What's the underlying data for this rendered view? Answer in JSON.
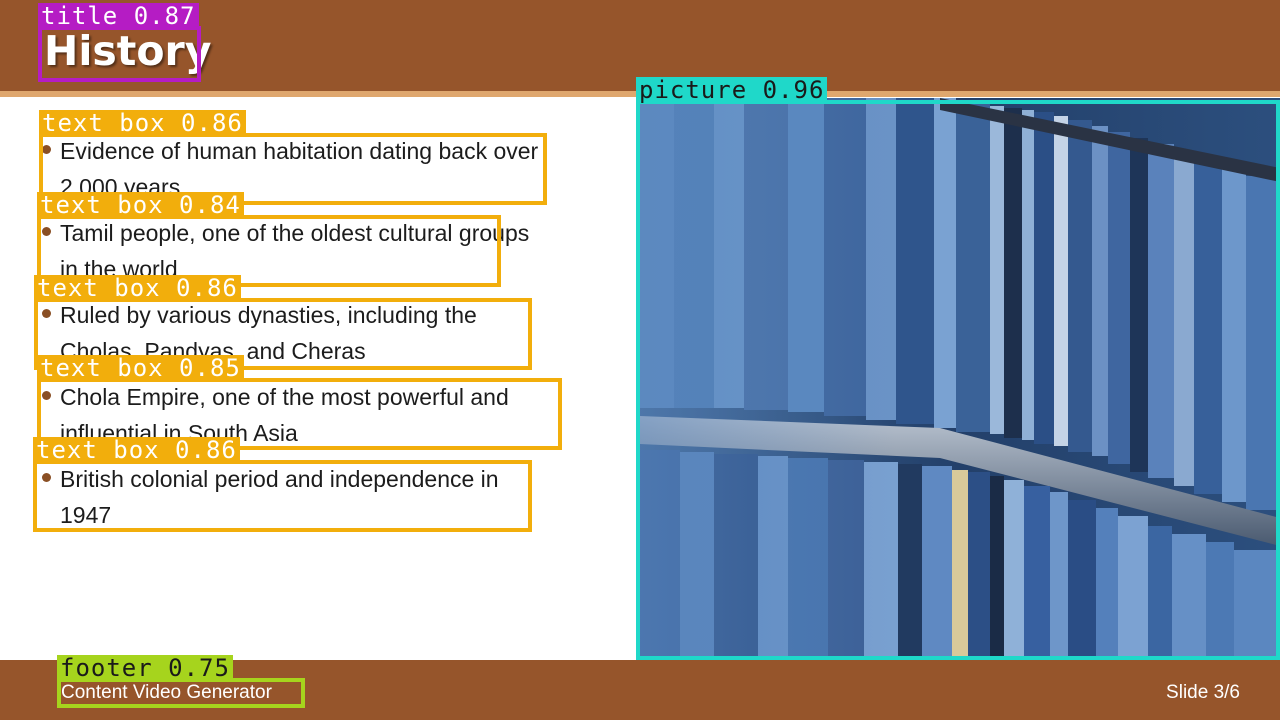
{
  "slide": {
    "title": "History",
    "bullets": [
      "Evidence of human habitation dating back over 2,000 years",
      "Tamil people, one of the oldest cultural groups in the world",
      "Ruled by various dynasties, including the Cholas, Pandyas, and Cheras",
      "Chola Empire, one of the most powerful and influential in South Asia",
      "British colonial period and independence in 1947"
    ],
    "footer": "Content Video Generator",
    "slide_number": "Slide 3/6"
  },
  "detections": [
    {
      "label": "title 0.87"
    },
    {
      "label": "text box 0.86"
    },
    {
      "label": "text box 0.84"
    },
    {
      "label": "text box 0.86"
    },
    {
      "label": "text box 0.85"
    },
    {
      "label": "text box 0.86"
    },
    {
      "label": "picture 0.96"
    },
    {
      "label": "footer 0.75"
    }
  ],
  "icons": {
    "bullet": "bullet-dot-icon",
    "picture": "bookshelf-photo"
  },
  "colors": {
    "band": "#96552b",
    "rule": "#dfa76e",
    "bullet": "#8a4f24",
    "title_box": "#b51cc4",
    "text_box": "#f2ae0c",
    "picture_box": "#1fd8c9",
    "footer_box": "#a6d41d"
  }
}
